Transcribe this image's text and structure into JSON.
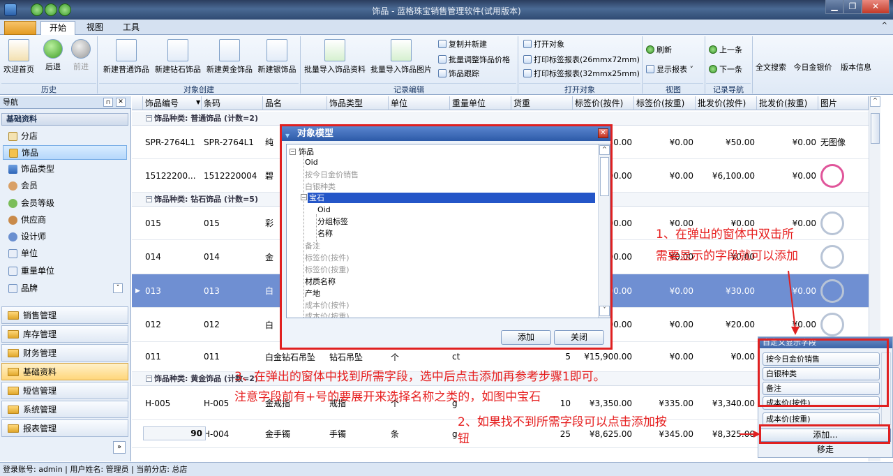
{
  "window": {
    "title": "饰品 - 蓝格珠宝销售管理软件(试用版本)",
    "minimize": "▁",
    "restore": "❐",
    "close": "✕"
  },
  "ribbon_tabs": [
    "开始",
    "视图",
    "工具"
  ],
  "ribbon": {
    "history": {
      "home": "欢迎首页",
      "back": "后退",
      "forward": "前进",
      "group": "历史"
    },
    "create": {
      "normal": "新建普通饰品",
      "diamond": "新建钻石饰品",
      "gold": "新建黄金饰品",
      "silver": "新建银饰品",
      "group": "对象创建"
    },
    "edit": {
      "batch_import": "批量导入饰品资料",
      "batch_image": "批量导入饰品图片",
      "copy_new": "复制并新建",
      "batch_price": "批量调整饰品价格",
      "track": "饰品跟踪",
      "group": "记录编辑"
    },
    "open": {
      "open_obj": "打开对象",
      "print26": "打印标签报表(26mmx72mm)",
      "print32": "打印标签报表(32mmx25mm)",
      "group": "打开对象"
    },
    "view": {
      "refresh": "刷新",
      "show_report": "显示报表",
      "group": "视图"
    },
    "nav": {
      "prev": "上一条",
      "next": "下一条",
      "group": "记录导航"
    },
    "fulltext": "全文搜索",
    "gold_price": "今日金银价",
    "version": "版本信息"
  },
  "nav": {
    "header": "导航",
    "section": "基础资料",
    "items": [
      "分店",
      "饰品",
      "饰品类型",
      "会员",
      "会员等级",
      "供应商",
      "设计师",
      "单位",
      "重量单位",
      "品牌"
    ],
    "modules": [
      "销售管理",
      "库存管理",
      "财务管理",
      "基础资料",
      "短信管理",
      "系统管理",
      "报表管理"
    ]
  },
  "grid": {
    "columns": [
      "饰品编号",
      "条码",
      "品名",
      "饰品类型",
      "单位",
      "重量单位",
      "货重",
      "标签价(按件)",
      "标签价(按重)",
      "批发价(按件)",
      "批发价(按重)",
      "图片"
    ],
    "groups": [
      {
        "label": "饰品种类: 普通饰品 (计数=2)"
      },
      {
        "label": "饰品种类: 钻石饰品 (计数=5)"
      },
      {
        "label": "饰品种类: 黄金饰品 (计数=2)"
      }
    ],
    "rows": [
      {
        "id": "SPR-2764L1",
        "code": "SPR-2764L1",
        "name": "纯",
        "type": "",
        "unit": "",
        "wunit": "",
        "weight": "",
        "tag": "50.00",
        "tagw": "¥0.00",
        "whole": "¥50.00",
        "wholew": "¥0.00",
        "img": "无图像"
      },
      {
        "id": "15122200...",
        "code": "1512220004",
        "name": "碧",
        "type": "",
        "unit": "",
        "wunit": "",
        "weight": "",
        "tag": "00.00",
        "tagw": "¥0.00",
        "whole": "¥6,100.00",
        "wholew": "¥0.00",
        "img": ""
      },
      {
        "id": "015",
        "code": "015",
        "name": "彩",
        "type": "",
        "unit": "",
        "wunit": "",
        "weight": "",
        "tag": "00.00",
        "tagw": "¥0.00",
        "whole": "¥0.00",
        "wholew": "¥0.00",
        "img": ""
      },
      {
        "id": "014",
        "code": "014",
        "name": "金",
        "type": "",
        "unit": "",
        "wunit": "",
        "weight": "",
        "tag": "00.00",
        "tagw": "¥0.00",
        "whole": "¥0.00",
        "wholew": "",
        "img": ""
      },
      {
        "id": "013",
        "code": "013",
        "name": "白",
        "type": "",
        "unit": "",
        "wunit": "",
        "weight": "",
        "tag": "00.00",
        "tagw": "¥0.00",
        "whole": "¥30.00",
        "wholew": "¥0.00",
        "img": ""
      },
      {
        "id": "012",
        "code": "012",
        "name": "白",
        "type": "",
        "unit": "",
        "wunit": "",
        "weight": "",
        "tag": "00.00",
        "tagw": "¥0.00",
        "whole": "¥20.00",
        "wholew": "¥0.00",
        "img": ""
      },
      {
        "id": "011",
        "code": "011",
        "name": "白金钻石吊坠",
        "type": "钻石吊坠",
        "unit": "个",
        "wunit": "ct",
        "weight": "5",
        "tag": "¥15,900.00",
        "tagw": "¥0.00",
        "whole": "¥0.00",
        "wholew": "¥0.00",
        "img": ""
      },
      {
        "id": "H-005",
        "code": "H-005",
        "name": "金戒指",
        "type": "戒指",
        "unit": "个",
        "wunit": "g",
        "weight": "10",
        "tag": "¥3,350.00",
        "tagw": "¥335.00",
        "whole": "¥3,340.00",
        "wholew": "",
        "img": ""
      },
      {
        "id": "H-004",
        "code": "H-004",
        "name": "金手镯",
        "type": "手镯",
        "unit": "条",
        "wunit": "g",
        "weight": "25",
        "tag": "¥8,625.00",
        "tagw": "¥345.00",
        "whole": "¥8,325.00",
        "wholew": "",
        "img": ""
      }
    ],
    "footer_count": "90"
  },
  "status": "登录账号: admin  |  用户姓名: 管理员  |  当前分店: 总店",
  "dialog": {
    "title": "对象模型",
    "tree": {
      "root": "饰品",
      "n_oid": "Oid",
      "n_gold": "按今日金价销售",
      "n_silver": "白银种类",
      "n_gem": "宝石",
      "n_gem_oid": "Oid",
      "n_gem_tag": "分组标签",
      "n_gem_name": "名称",
      "n_note": "备注",
      "n_tag_piece": "标签价(按件)",
      "n_tag_weight": "标签价(按重)",
      "n_material": "材质名称",
      "n_origin": "产地",
      "n_cost_piece": "成本价(按件)",
      "n_cost_weight": "成本价(按重)"
    },
    "add": "添加",
    "close": "关闭"
  },
  "custom_fields": {
    "title": "自定义显示字段",
    "items": [
      "按今日金价销售",
      "白银种类",
      "备注",
      "成本价(按件)",
      "成本价(按重)"
    ],
    "add": "添加...",
    "remove": "移走"
  },
  "annotations": {
    "a1_l1": "1、在弹出的窗体中双击所",
    "a1_l2": "需要显示的字段就可以添加",
    "a2_l1": "2、如果找不到所需字段可以点击添加按",
    "a2_l2": "钮",
    "a3_l1": "3、在弹出的窗体中找到所需字段，选中后点击添加再参考步骤1即可。",
    "a3_l2": "注意字段前有+号的要展开来选择名称之类的，如图中宝石"
  }
}
